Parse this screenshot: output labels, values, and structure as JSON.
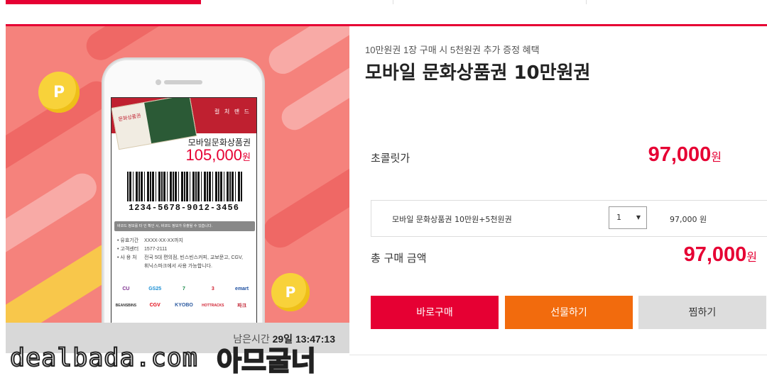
{
  "hero": {
    "ticket_culture": "컬 처 랜 드",
    "ticket_banner": "문화상품권",
    "product_name": "모바일문화상품권",
    "product_price": "105,000",
    "price_unit": "원",
    "barcode_number": "1234-5678-9012-3456",
    "warning_text": "바코드 정보를 타 인 확인 시, 바코드 정보가 유출될 수 있습니다.",
    "info": [
      {
        "key": "• 유효기간",
        "value": "XXXX-XX-XX까지"
      },
      {
        "key": "• 고객센터",
        "value": "1577-2111"
      },
      {
        "key": "• 사 용 처",
        "value": "전국 5대 편의점, 빈스빈스커피, 교보문고, CGV, 휘닉스파크에서 사용 가능합니다."
      }
    ],
    "logos": [
      "CU",
      "GS25",
      "7",
      "3",
      "emart",
      "BEANSBINS",
      "CGV",
      "KYOBO",
      "HOTTRACKS",
      "파크"
    ],
    "coin_label": "P"
  },
  "timer": {
    "label": "남은시간",
    "days": "29일",
    "time": "13:47:13"
  },
  "watermark": {
    "site": "dealbada.com",
    "user": "아므굴너"
  },
  "product": {
    "promo": "10만원권 1장 구매 시 5천원권 추가 증정 혜택",
    "title": "모바일 문화상품권 10만원권",
    "price_label": "초콜릿가",
    "price": "97,000",
    "price_unit": "원"
  },
  "option": {
    "name": "모바일 문화상품권 10만원+5천원권",
    "quantity": "1",
    "price": "97,000 원"
  },
  "total": {
    "label": "총 구매 금액",
    "amount": "97,000",
    "unit": "원"
  },
  "buttons": {
    "buy": "바로구매",
    "gift": "선물하기",
    "wish": "찜하기"
  },
  "colors": {
    "accent": "#e60033",
    "gift": "#f26b0d",
    "hero_bg": "#f5827c"
  }
}
